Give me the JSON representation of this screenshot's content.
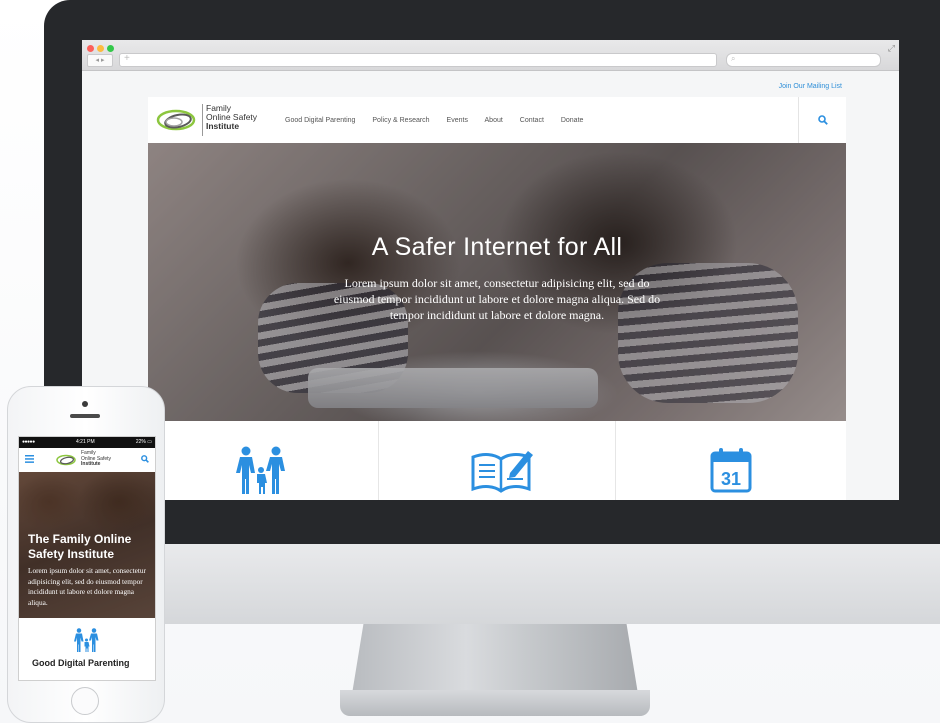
{
  "browser": {
    "nav_arrows": "◂ ▸",
    "new_tab_symbol": "+",
    "search_symbol": "⌕",
    "expand_symbol": "⤢"
  },
  "desktop": {
    "mailing_link": "Join Our Mailing List",
    "logo": {
      "line1": "Family",
      "line2": "Online Safety",
      "line3": "Institute"
    },
    "nav": [
      "Good Digital Parenting",
      "Policy & Research",
      "Events",
      "About",
      "Contact",
      "Donate"
    ],
    "hero": {
      "title": "A Safer Internet for All",
      "text": "Lorem ipsum dolor sit amet, consectetur adipisicing elit, sed do eiusmod tempor incididunt ut labore et dolore magna aliqua. Sed do  tempor incididunt ut labore et dolore magna."
    },
    "features": [
      {
        "icon": "family-icon"
      },
      {
        "icon": "book-pencil-icon"
      },
      {
        "icon": "calendar-icon",
        "day": "31"
      }
    ],
    "accent_color": "#2b8fe0"
  },
  "mobile": {
    "status": {
      "signal": "●●●●● ",
      "time": "4:21 PM",
      "battery": "22% ▭"
    },
    "logo": {
      "line1": "Family",
      "line2": "Online Safety",
      "line3": "Institute"
    },
    "hero": {
      "title": "The Family Online Safety Institute",
      "text": "Lorem ipsum dolor sit amet, consectetur adipisicing elit, sed do eiusmod tempor incididunt ut labore et dolore magna aliqua."
    },
    "feature_label": "Good Digital Parenting"
  }
}
